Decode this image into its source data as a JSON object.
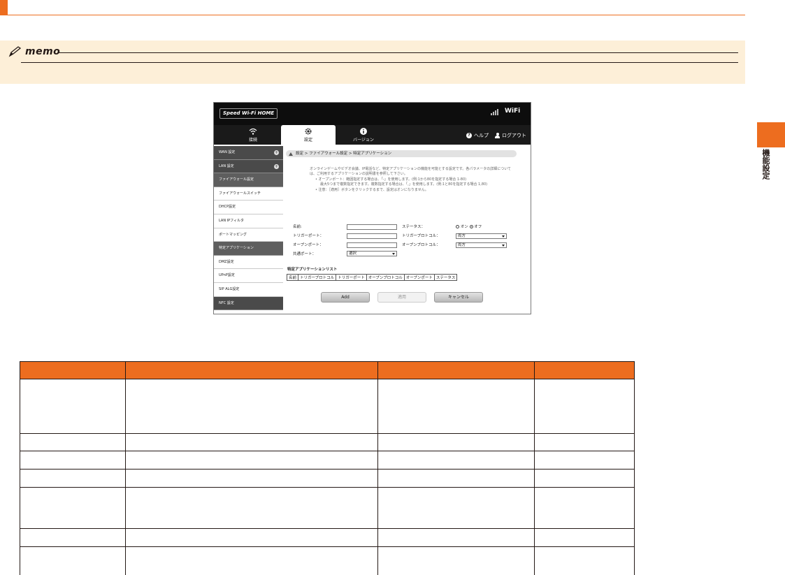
{
  "colors": {
    "accent": "#ed6d1f",
    "memo_bg": "#fdefd8"
  },
  "memo": {
    "word": "memo"
  },
  "side_tab": {
    "label": "機能設定"
  },
  "screenshot": {
    "brand": "Speed Wi-Fi HOME",
    "wifi_badge": "WiFi",
    "nav": {
      "tabs": [
        {
          "label": "接続",
          "icon": "wifi-icon"
        },
        {
          "label": "設定",
          "icon": "gear-icon"
        },
        {
          "label": "バージョン",
          "icon": "info-icon"
        }
      ],
      "help": "ヘルプ",
      "logout": "ログアウト"
    },
    "sidebar": {
      "items": [
        {
          "label": "WAN 設定",
          "style": "dark",
          "plus": "+"
        },
        {
          "label": "LAN 設定",
          "style": "dark",
          "plus": "+"
        },
        {
          "label": "ファイアウォール設定",
          "style": "section"
        },
        {
          "label": "ファイアウォールスイッチ",
          "style": "plain"
        },
        {
          "label": "DHCP設定",
          "style": "plain"
        },
        {
          "label": "LAN IPフィルタ",
          "style": "plain"
        },
        {
          "label": "ポートマッピング",
          "style": "plain"
        },
        {
          "label": "特定アプリケーション",
          "style": "section"
        },
        {
          "label": "DMZ設定",
          "style": "plain"
        },
        {
          "label": "UPnP設定",
          "style": "plain"
        },
        {
          "label": "SIP ALG設定",
          "style": "plain"
        },
        {
          "label": "NFC 設定",
          "style": "dark"
        }
      ]
    },
    "breadcrumb": "設定 > ファイアウォール設定 > 特定アプリケーション",
    "description": {
      "intro": "オンラインゲームやビデオ会議、IP電話など、特定アプリケーションの機能を可能とする設定です。各パラメータの詳細については、ご利用するアプリケーションの説明書を参照して下さい。",
      "bullet1": "• オープンポート：範囲指定する場合は、「-」を使用します。(例:1から80を指定する場合 1-80)",
      "bullet1_cont": "最大5つまで複数指定できます。複数指定する場合は、「,」を使用します。(例:1と80を指定する場合 1,80)",
      "bullet2": "• 注意：［適用］ボタンをクリックするまで、設定はオンになりません。"
    },
    "form": {
      "name_label": "名前:",
      "trigger_port_label": "トリガーポート：",
      "open_port_label": "オープンポート：",
      "shared_port_label": "共通ポート：",
      "shared_port_value": "選択",
      "status_label": "ステータス：",
      "status_on": "オン",
      "status_off": "オフ",
      "status_selected": "オフ",
      "trigger_protocol_label": "トリガープロトコル：",
      "trigger_protocol_value": "両方",
      "open_protocol_label": "オープンプロトコル：",
      "open_protocol_value": "両方"
    },
    "list": {
      "title": "特定アプリケーションリスト",
      "columns": [
        "名前",
        "トリガープロトコル",
        "トリガーポート",
        "オープンプロトコル",
        "オープンポート",
        "ステータス"
      ]
    },
    "buttons": {
      "add": "Add",
      "apply": "適用",
      "cancel": "キャンセル"
    }
  },
  "main_table": {
    "headers": [
      "",
      "",
      "",
      ""
    ],
    "rows": [
      [
        "",
        "",
        "",
        ""
      ],
      [
        "",
        "",
        "",
        ""
      ],
      [
        "",
        "",
        "",
        ""
      ],
      [
        "",
        "",
        "",
        ""
      ],
      [
        "",
        "",
        "",
        ""
      ],
      [
        "",
        "",
        "",
        ""
      ],
      [
        "",
        "",
        "",
        ""
      ]
    ]
  }
}
